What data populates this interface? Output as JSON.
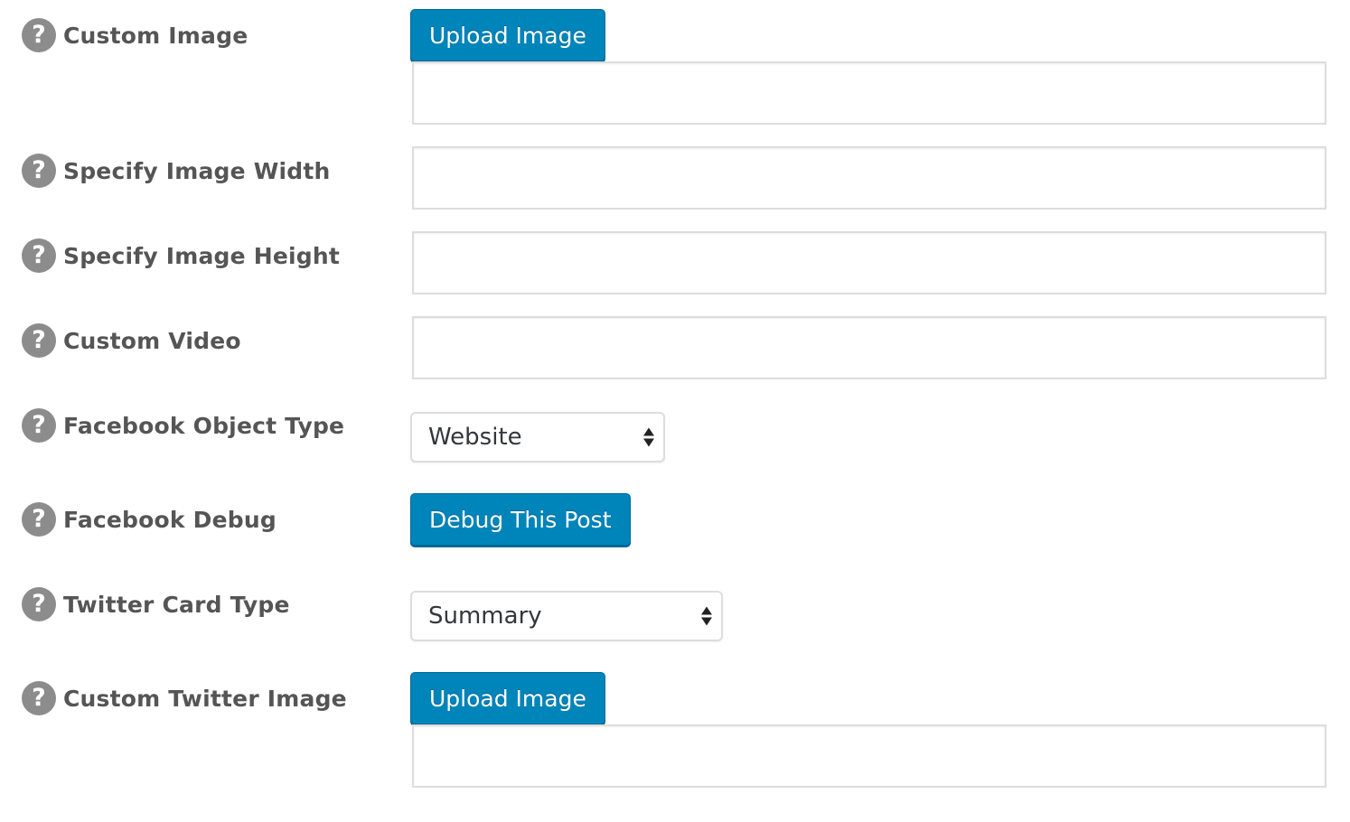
{
  "colors": {
    "button_bg": "#0085ba",
    "button_border": "#006799",
    "label_text": "#555555",
    "help_icon_bg": "#8c8c8c",
    "input_border": "#dddddd"
  },
  "help_icon_glyph": "?",
  "fields": {
    "custom_image": {
      "label": "Custom Image",
      "button_label": "Upload Image",
      "value": ""
    },
    "image_width": {
      "label": "Specify Image Width",
      "value": ""
    },
    "image_height": {
      "label": "Specify Image Height",
      "value": ""
    },
    "custom_video": {
      "label": "Custom Video",
      "value": ""
    },
    "facebook_object_type": {
      "label": "Facebook Object Type",
      "selected": "Website"
    },
    "facebook_debug": {
      "label": "Facebook Debug",
      "button_label": "Debug This Post"
    },
    "twitter_card_type": {
      "label": "Twitter Card Type",
      "selected": "Summary"
    },
    "custom_twitter_image": {
      "label": "Custom Twitter Image",
      "button_label": "Upload Image",
      "value": ""
    }
  }
}
